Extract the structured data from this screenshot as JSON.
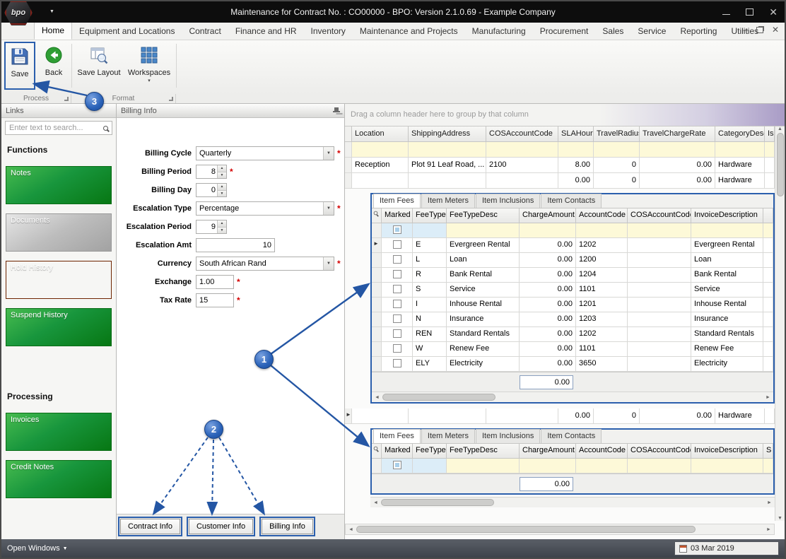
{
  "colors": {
    "annotation_blue": "#2b5fad",
    "green_button": "#18963d",
    "rust_button": "#8a3000",
    "gray_button": "#bdbdbd",
    "filter_yellow": "#fdf9d8",
    "filter_cyan": "#dcedf8",
    "titlebar": "#0d0d0d",
    "statusbar": "#464b53"
  },
  "window": {
    "title": "Maintenance for Contract No. : CO00000    - BPO: Version 2.1.0.69 - Example Company",
    "logo_text": "bpo"
  },
  "ribbon": {
    "tabs": [
      {
        "label": "Home"
      },
      {
        "label": "Equipment and Locations"
      },
      {
        "label": "Contract"
      },
      {
        "label": "Finance and HR"
      },
      {
        "label": "Inventory"
      },
      {
        "label": "Maintenance and Projects"
      },
      {
        "label": "Manufacturing"
      },
      {
        "label": "Procurement"
      },
      {
        "label": "Sales"
      },
      {
        "label": "Service"
      },
      {
        "label": "Reporting"
      },
      {
        "label": "Utilities"
      }
    ],
    "buttons": {
      "save": "Save",
      "back": "Back",
      "save_layout": "Save Layout",
      "workspaces": "Workspaces"
    },
    "groups": {
      "process": "Process",
      "format": "Format"
    }
  },
  "links_panel": {
    "title": "Links",
    "search_placeholder": "Enter text to search...",
    "functions_heading": "Functions",
    "processing_heading": "Processing",
    "function_buttons": [
      {
        "label": "Notes",
        "style": "green"
      },
      {
        "label": "Documents",
        "style": "gray"
      },
      {
        "label": "Hold History",
        "style": "rust"
      },
      {
        "label": "Suspend History",
        "style": "green"
      }
    ],
    "processing_buttons": [
      {
        "label": "Invoices",
        "style": "green"
      },
      {
        "label": "Credit Notes",
        "style": "green"
      }
    ]
  },
  "billing_panel": {
    "title": "Billing Info",
    "fields": {
      "billing_cycle": {
        "label": "Billing Cycle",
        "value": "Quarterly",
        "required": "*"
      },
      "billing_period": {
        "label": "Billing Period",
        "value": "8",
        "required": "*"
      },
      "billing_day": {
        "label": "Billing Day",
        "value": "0"
      },
      "escalation_type": {
        "label": "Escalation Type",
        "value": "Percentage",
        "required": "*"
      },
      "escalation_period": {
        "label": "Escalation Period",
        "value": "9"
      },
      "escalation_amt": {
        "label": "Escalation Amt",
        "value": "10"
      },
      "currency": {
        "label": "Currency",
        "value": "South African Rand",
        "required": "*"
      },
      "exchange": {
        "label": "Exchange",
        "value": "1.00",
        "required": "*"
      },
      "tax_rate": {
        "label": "Tax Rate",
        "value": "15",
        "required": "*"
      }
    },
    "bottom_tabs": [
      "Contract Info",
      "Customer Info",
      "Billing Info"
    ]
  },
  "grid": {
    "group_hint": "Drag a column header here to group by that column",
    "columns": [
      "Location",
      "ShippingAddress",
      "COSAccountCode",
      "SLAHours",
      "TravelRadius",
      "TravelChargeRate",
      "CategoryDesc",
      "IsE"
    ],
    "rows": [
      {
        "location": "Reception",
        "shipping_address": "Plot 91 Leaf Road, ...",
        "cos_account_code": "2100",
        "sla_hours": "8.00",
        "travel_radius": "0",
        "travel_charge_rate": "0.00",
        "category_desc": "Hardware"
      },
      {
        "location": "",
        "shipping_address": "",
        "cos_account_code": "",
        "sla_hours": "0.00",
        "travel_radius": "0",
        "travel_charge_rate": "0.00",
        "category_desc": "Hardware"
      },
      {
        "location": "",
        "shipping_address": "",
        "cos_account_code": "",
        "sla_hours": "0.00",
        "travel_radius": "0",
        "travel_charge_rate": "0.00",
        "category_desc": "Hardware"
      }
    ],
    "detail": {
      "tabs": [
        "Item Fees",
        "Item Meters",
        "Item Inclusions",
        "Item Contacts"
      ],
      "active_tab": "Item Fees",
      "columns": [
        "Marked",
        "FeeType",
        "FeeTypeDesc",
        "ChargeAmount",
        "AccountCode",
        "COSAccountCode",
        "InvoiceDescription"
      ],
      "partial_column": "S",
      "fee_rows": [
        {
          "fee_type": "E",
          "fee_type_desc": "Evergreen Rental",
          "charge_amount": "0.00",
          "account_code": "1202",
          "cos_account_code": "",
          "invoice_description": "Evergreen Rental"
        },
        {
          "fee_type": "L",
          "fee_type_desc": "Loan",
          "charge_amount": "0.00",
          "account_code": "1200",
          "cos_account_code": "",
          "invoice_description": "Loan"
        },
        {
          "fee_type": "R",
          "fee_type_desc": "Bank Rental",
          "charge_amount": "0.00",
          "account_code": "1204",
          "cos_account_code": "",
          "invoice_description": "Bank Rental"
        },
        {
          "fee_type": "S",
          "fee_type_desc": "Service",
          "charge_amount": "0.00",
          "account_code": "1101",
          "cos_account_code": "",
          "invoice_description": "Service"
        },
        {
          "fee_type": "I",
          "fee_type_desc": "Inhouse Rental",
          "charge_amount": "0.00",
          "account_code": "1201",
          "cos_account_code": "",
          "invoice_description": "Inhouse Rental"
        },
        {
          "fee_type": "N",
          "fee_type_desc": "Insurance",
          "charge_amount": "0.00",
          "account_code": "1203",
          "cos_account_code": "",
          "invoice_description": "Insurance"
        },
        {
          "fee_type": "REN",
          "fee_type_desc": "Standard Rentals",
          "charge_amount": "0.00",
          "account_code": "1202",
          "cos_account_code": "",
          "invoice_description": "Standard Rentals"
        },
        {
          "fee_type": "W",
          "fee_type_desc": "Renew Fee",
          "charge_amount": "0.00",
          "account_code": "1101",
          "cos_account_code": "",
          "invoice_description": "Renew Fee"
        },
        {
          "fee_type": "ELY",
          "fee_type_desc": "Electricity",
          "charge_amount": "0.00",
          "account_code": "3650",
          "cos_account_code": "",
          "invoice_description": "Electricity"
        }
      ],
      "footer_total": "0.00"
    }
  },
  "callouts": {
    "c1": "1",
    "c2": "2",
    "c3": "3"
  },
  "status_bar": {
    "open_windows": "Open Windows",
    "date": "03 Mar 2019"
  }
}
